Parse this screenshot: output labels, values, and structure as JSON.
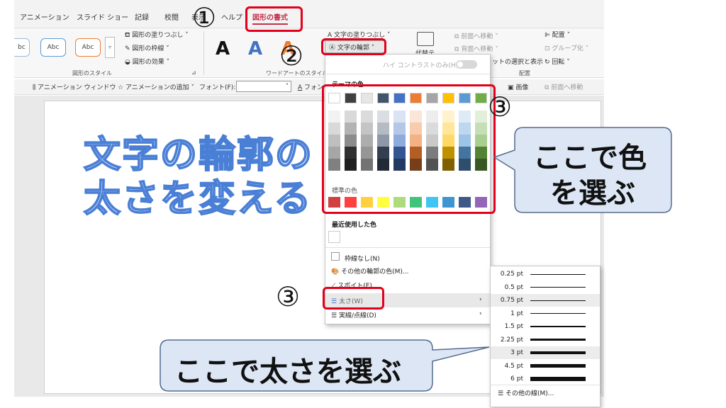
{
  "tabs": [
    "アニメーション",
    "スライド ショー",
    "記録",
    "校閲",
    "表示",
    "ヘルプ",
    "図形の書式"
  ],
  "ribbon": {
    "shape_styles": [
      "Abc",
      "Abc",
      "Abc"
    ],
    "shape_fill": "図形の塗りつぶし",
    "shape_outline": "図形の枠線",
    "shape_effects": "図形の効果",
    "group_shape_styles": "図形のスタイル",
    "wordart_letters": [
      "A",
      "A",
      "A"
    ],
    "text_fill": "文字の塗りつぶし",
    "text_outline": "文字の輪郭",
    "group_wordart": "ワードアートのスタイル",
    "alt_text": "代替テ",
    "bring_forward": "前面へ移動",
    "send_backward": "背面へ移動",
    "selection_pane": "ットの選択と表示",
    "group_arrange": "配置",
    "align": "配置",
    "group": "グループ化",
    "rotate": "回転"
  },
  "quickbar": {
    "animation_window": "アニメーション ウィンドウ",
    "add_animation": "アニメーションの追加",
    "font_label": "フォント(F):",
    "font_short": "フォン",
    "image": "画像",
    "bring_forward": "前面へ移動"
  },
  "slide": {
    "line1": "文字の輪郭の",
    "line2": "太さを変える"
  },
  "dropdown": {
    "high_contrast": "ハイ コントラストのみ(H)",
    "theme_colors": "テーマの色",
    "standard_colors": "標準の色",
    "recent_colors": "最近使用した色",
    "no_outline": "枠線なし(N)",
    "more_colors": "その他の輪郭の色(M)...",
    "eyedropper": "スポイト(E)",
    "weight": "太さ(W)",
    "dashes": "実線/点線(D)"
  },
  "submenu": {
    "weights": [
      "0.25 pt",
      "0.5 pt",
      "0.75 pt",
      "1 pt",
      "1.5 pt",
      "2.25 pt",
      "3 pt",
      "4.5 pt",
      "6 pt"
    ],
    "more_lines": "その他の線(M)..."
  },
  "annotations": {
    "step1": "①",
    "step2": "②",
    "step3a": "③",
    "step3b": "③",
    "bubble_color_line1": "ここで色",
    "bubble_color_line2": "を選ぶ",
    "bubble_weight": "ここで太さを選ぶ"
  },
  "colors": {
    "accent_red": "#e3001b",
    "outline_blue": "#4a7fd6",
    "bubble_fill": "#dce6f5",
    "theme_top": [
      "#ffffff",
      "#404040",
      "#e7e6e6",
      "#44546a",
      "#4472c4",
      "#ed7d31",
      "#a5a5a5",
      "#ffc000",
      "#5b9bd5",
      "#70ad47"
    ],
    "standard": [
      "#c00000",
      "#ff0000",
      "#ffc000",
      "#ffff00",
      "#92d050",
      "#00b050",
      "#00b0f0",
      "#0070c0",
      "#002060",
      "#7030a0"
    ]
  }
}
